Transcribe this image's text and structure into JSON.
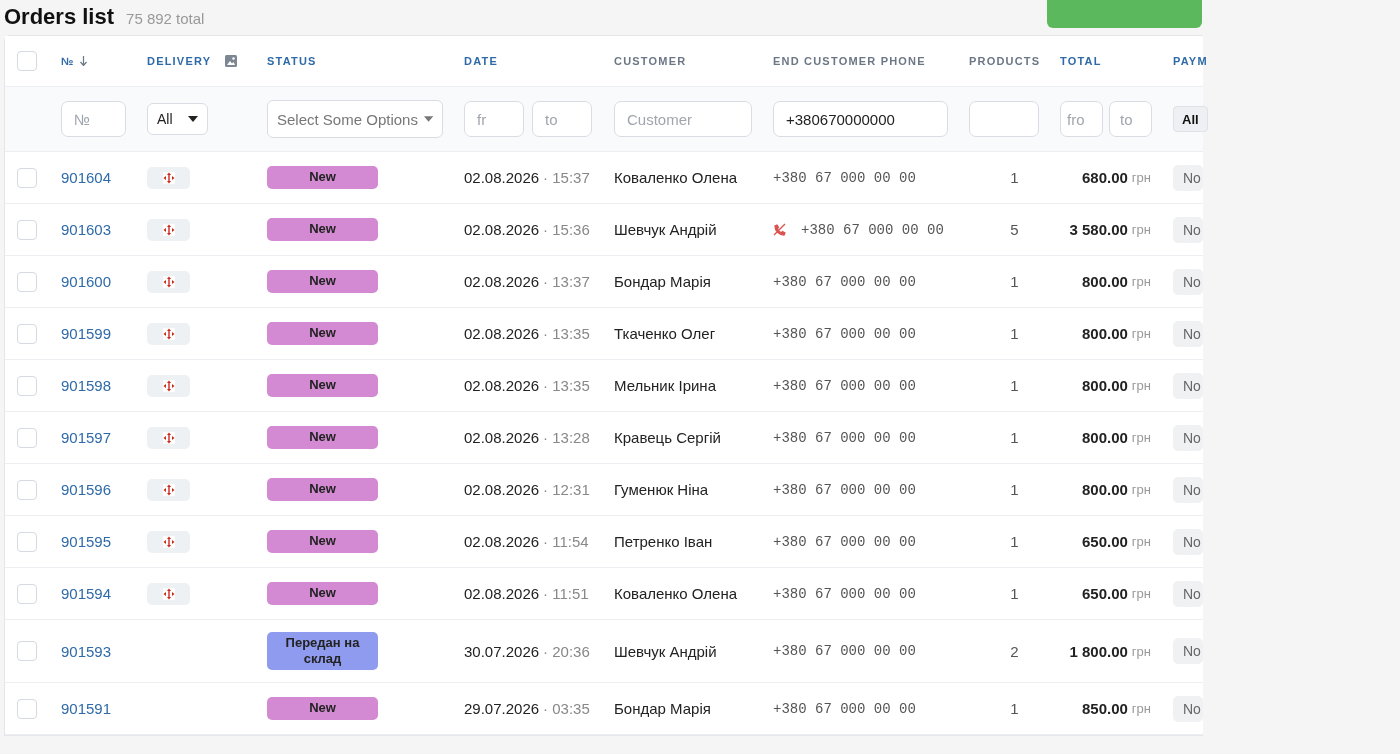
{
  "page": {
    "title": "Orders list",
    "total_count": "75 892 total"
  },
  "table": {
    "select_all_checked": false,
    "columns": [
      {
        "label": "№",
        "sortable": true,
        "sorted": true
      },
      {
        "label": "DELIVERY",
        "sortable": true,
        "sorted": false
      },
      {
        "label": "STATUS",
        "sortable": true,
        "sorted": false
      },
      {
        "label": "DATE",
        "sortable": true,
        "sorted": false
      },
      {
        "label": "CUSTOMER",
        "sortable": false,
        "sorted": false
      },
      {
        "label": "END CUSTOMER PHONE",
        "sortable": false,
        "sorted": false
      },
      {
        "label": "PRODUCTS",
        "sortable": false,
        "sorted": false
      },
      {
        "label": "TOTAL",
        "sortable": true,
        "sorted": false
      },
      {
        "label": "PAYM",
        "sortable": true,
        "sorted": false
      }
    ],
    "filters": {
      "number": {
        "placeholder": "№"
      },
      "delivery": {
        "value": "All"
      },
      "status": {
        "placeholder": "Select Some Options"
      },
      "date_from": {
        "placeholder": "fr"
      },
      "date_to": {
        "placeholder": "to"
      },
      "customer": {
        "placeholder": "Customer"
      },
      "phone": {
        "value": "+380670000000"
      },
      "total_from": {
        "placeholder": "fro"
      },
      "total_to": {
        "placeholder": "to"
      },
      "payment": {
        "value": "All"
      }
    },
    "rows": [
      {
        "checked": false,
        "number": "901604",
        "delivery": true,
        "status": {
          "label": "New",
          "color": "#d38ad2"
        },
        "date": "02.08.2026",
        "time": "· 15:37",
        "customer": "Коваленко Олена",
        "phone": "+380 67 000 00 00",
        "phone_flag": false,
        "products": "1",
        "total": "680.00",
        "currency": "грн",
        "payment": "No"
      },
      {
        "checked": false,
        "number": "901603",
        "delivery": true,
        "status": {
          "label": "New",
          "color": "#d38ad2"
        },
        "date": "02.08.2026",
        "time": "· 15:36",
        "customer": "Шевчук Андрій",
        "phone": "+380 67 000 00 00",
        "phone_flag": true,
        "products": "5",
        "total": "3 580.00",
        "currency": "грн",
        "payment": "No"
      },
      {
        "checked": false,
        "number": "901600",
        "delivery": true,
        "status": {
          "label": "New",
          "color": "#d38ad2"
        },
        "date": "02.08.2026",
        "time": "· 13:37",
        "customer": "Бондар Марія",
        "phone": "+380 67 000 00 00",
        "phone_flag": false,
        "products": "1",
        "total": "800.00",
        "currency": "грн",
        "payment": "No"
      },
      {
        "checked": false,
        "number": "901599",
        "delivery": true,
        "status": {
          "label": "New",
          "color": "#d38ad2"
        },
        "date": "02.08.2026",
        "time": "· 13:35",
        "customer": "Ткаченко Олег",
        "phone": "+380 67 000 00 00",
        "phone_flag": false,
        "products": "1",
        "total": "800.00",
        "currency": "грн",
        "payment": "No"
      },
      {
        "checked": false,
        "number": "901598",
        "delivery": true,
        "status": {
          "label": "New",
          "color": "#d38ad2"
        },
        "date": "02.08.2026",
        "time": "· 13:35",
        "customer": "Мельник Ірина",
        "phone": "+380 67 000 00 00",
        "phone_flag": false,
        "products": "1",
        "total": "800.00",
        "currency": "грн",
        "payment": "No"
      },
      {
        "checked": false,
        "number": "901597",
        "delivery": true,
        "status": {
          "label": "New",
          "color": "#d38ad2"
        },
        "date": "02.08.2026",
        "time": "· 13:28",
        "customer": "Кравець Сергій",
        "phone": "+380 67 000 00 00",
        "phone_flag": false,
        "products": "1",
        "total": "800.00",
        "currency": "грн",
        "payment": "No"
      },
      {
        "checked": false,
        "number": "901596",
        "delivery": true,
        "status": {
          "label": "New",
          "color": "#d38ad2"
        },
        "date": "02.08.2026",
        "time": "· 12:31",
        "customer": "Гуменюк Ніна",
        "phone": "+380 67 000 00 00",
        "phone_flag": false,
        "products": "1",
        "total": "800.00",
        "currency": "грн",
        "payment": "No"
      },
      {
        "checked": false,
        "number": "901595",
        "delivery": true,
        "status": {
          "label": "New",
          "color": "#d38ad2"
        },
        "date": "02.08.2026",
        "time": "· 11:54",
        "customer": "Петренко Іван",
        "phone": "+380 67 000 00 00",
        "phone_flag": false,
        "products": "1",
        "total": "650.00",
        "currency": "грн",
        "payment": "No"
      },
      {
        "checked": false,
        "number": "901594",
        "delivery": true,
        "status": {
          "label": "New",
          "color": "#d38ad2"
        },
        "date": "02.08.2026",
        "time": "· 11:51",
        "customer": "Коваленко Олена",
        "phone": "+380 67 000 00 00",
        "phone_flag": false,
        "products": "1",
        "total": "650.00",
        "currency": "грн",
        "payment": "No"
      },
      {
        "checked": false,
        "number": "901593",
        "delivery": false,
        "status": {
          "label": "Передан на склад",
          "color": "#8f9bee"
        },
        "date": "30.07.2026",
        "time": "· 20:36",
        "customer": "Шевчук Андрій",
        "phone": "+380 67 000 00 00",
        "phone_flag": false,
        "products": "2",
        "total": "1 800.00",
        "currency": "грн",
        "payment": "No"
      },
      {
        "checked": false,
        "number": "901591",
        "delivery": false,
        "status": {
          "label": "New",
          "color": "#d38ad2"
        },
        "date": "29.07.2026",
        "time": "· 03:35",
        "customer": "Бондар Марія",
        "phone": "+380 67 000 00 00",
        "phone_flag": false,
        "products": "1",
        "total": "850.00",
        "currency": "грн",
        "payment": "No"
      }
    ]
  }
}
